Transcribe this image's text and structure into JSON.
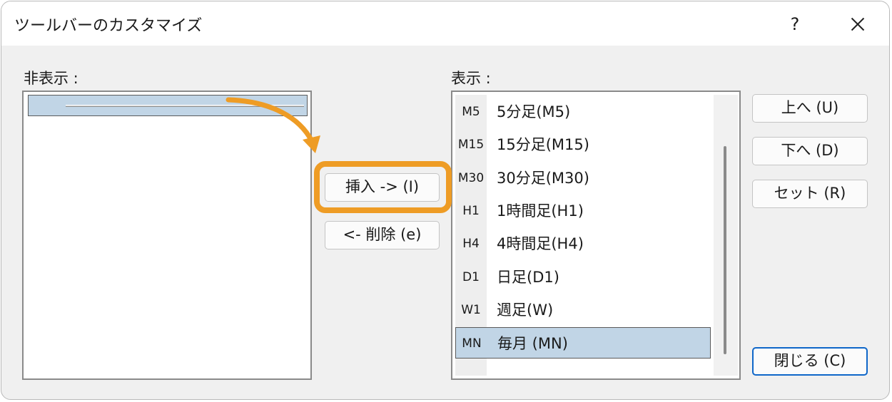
{
  "window": {
    "title": "ツールバーのカスタマイズ",
    "help_label": "?"
  },
  "hidden_list": {
    "label": "非表示 :"
  },
  "shown_list": {
    "label": "表示 :",
    "items": [
      {
        "icon": "M5",
        "label": "5分足(M5)"
      },
      {
        "icon": "M15",
        "label": "15分足(M15)"
      },
      {
        "icon": "M30",
        "label": "30分足(M30)"
      },
      {
        "icon": "H1",
        "label": "1時間足(H1)"
      },
      {
        "icon": "H4",
        "label": "4時間足(H4)"
      },
      {
        "icon": "D1",
        "label": "日足(D1)"
      },
      {
        "icon": "W1",
        "label": "週足(W)"
      },
      {
        "icon": "MN",
        "label": "毎月 (MN)",
        "selected": true
      }
    ]
  },
  "buttons": {
    "insert": "挿入 -> (I)",
    "delete": "<- 削除 (e)",
    "up": "上へ (U)",
    "down": "下へ (D)",
    "reset": "セット (R)",
    "close": "閉じる (C)"
  },
  "colors": {
    "highlight": "#ee9c25",
    "selection": "#c1d5e6",
    "default_button_border": "#0f67c9"
  }
}
